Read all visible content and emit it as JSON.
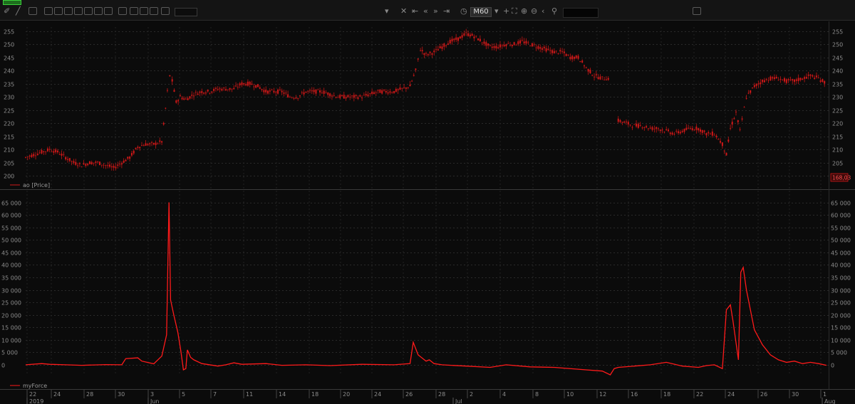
{
  "toolbar": {
    "timeframe": "M60"
  },
  "price_tag": "168,03",
  "chart_data": [
    {
      "type": "candlestick",
      "legend": "ao [Price]",
      "y_ticks": [
        255,
        250,
        245,
        240,
        235,
        230,
        225,
        220,
        215,
        210,
        205,
        200
      ],
      "ylim": [
        199.5,
        256.5
      ],
      "grid": true,
      "color": "#d01818",
      "series_points": [
        [
          0,
          207
        ],
        [
          1,
          208
        ],
        [
          2,
          209
        ],
        [
          3,
          210
        ],
        [
          4,
          209
        ],
        [
          5,
          207
        ],
        [
          6,
          205
        ],
        [
          7,
          204
        ],
        [
          8,
          205
        ],
        [
          9,
          205
        ],
        [
          10,
          204
        ],
        [
          11,
          203
        ],
        [
          12,
          205
        ],
        [
          13,
          207
        ],
        [
          14,
          211
        ],
        [
          15,
          212
        ],
        [
          16,
          212
        ],
        [
          17,
          213
        ],
        [
          17.7,
          232
        ],
        [
          18,
          238
        ],
        [
          18.3,
          236
        ],
        [
          18.8,
          228
        ],
        [
          19.3,
          230
        ],
        [
          20,
          229
        ],
        [
          21,
          231
        ],
        [
          22,
          232
        ],
        [
          23,
          232
        ],
        [
          24,
          233
        ],
        [
          25,
          233
        ],
        [
          26,
          233
        ],
        [
          27,
          235
        ],
        [
          28,
          235
        ],
        [
          29,
          234
        ],
        [
          30,
          232
        ],
        [
          31,
          232
        ],
        [
          32,
          232
        ],
        [
          33,
          230
        ],
        [
          34,
          230
        ],
        [
          35,
          232
        ],
        [
          36,
          232
        ],
        [
          37,
          232
        ],
        [
          38,
          231
        ],
        [
          39,
          230
        ],
        [
          40,
          230
        ],
        [
          41,
          230
        ],
        [
          42,
          230
        ],
        [
          43,
          231
        ],
        [
          44,
          232
        ],
        [
          45,
          232
        ],
        [
          46,
          232
        ],
        [
          47,
          233
        ],
        [
          48,
          234
        ],
        [
          48.7,
          240
        ],
        [
          49.3,
          248
        ],
        [
          50,
          246
        ],
        [
          51,
          247
        ],
        [
          52,
          249
        ],
        [
          53,
          251
        ],
        [
          54,
          252
        ],
        [
          55,
          254
        ],
        [
          56,
          253
        ],
        [
          57,
          251
        ],
        [
          58,
          249
        ],
        [
          59,
          249
        ],
        [
          60,
          250
        ],
        [
          61,
          250
        ],
        [
          62,
          251
        ],
        [
          63,
          250
        ],
        [
          64,
          249
        ],
        [
          65,
          248
        ],
        [
          66,
          247
        ],
        [
          67,
          247
        ],
        [
          68,
          245
        ],
        [
          69,
          245
        ],
        [
          70,
          241
        ],
        [
          71,
          238
        ],
        [
          72,
          237
        ],
        [
          73,
          237
        ],
        [
          74,
          221
        ],
        [
          75,
          220
        ],
        [
          76,
          219
        ],
        [
          77,
          219
        ],
        [
          78,
          218
        ],
        [
          79,
          218
        ],
        [
          80,
          217
        ],
        [
          81,
          216
        ],
        [
          82,
          217
        ],
        [
          83,
          218
        ],
        [
          84,
          218
        ],
        [
          85,
          216
        ],
        [
          86,
          216
        ],
        [
          87,
          212
        ],
        [
          87.5,
          208
        ],
        [
          88,
          218
        ],
        [
          88.7,
          224
        ],
        [
          89.2,
          217
        ],
        [
          90,
          230
        ],
        [
          91,
          234
        ],
        [
          92,
          236
        ],
        [
          93,
          237
        ],
        [
          94,
          237
        ],
        [
          95,
          236
        ],
        [
          96,
          236
        ],
        [
          97,
          237
        ],
        [
          98,
          238
        ],
        [
          99,
          237
        ],
        [
          100,
          235
        ]
      ]
    },
    {
      "type": "line",
      "legend": "myForce",
      "y_ticks": [
        65000,
        60000,
        55000,
        50000,
        45000,
        40000,
        35000,
        30000,
        25000,
        20000,
        15000,
        10000,
        5000,
        0
      ],
      "y_tick_labels": [
        "65 000",
        "60 000",
        "55 000",
        "50 000",
        "45 000",
        "40 000",
        "35 000",
        "30 000",
        "25 000",
        "20 000",
        "15 000",
        "10 000",
        "5 000",
        "0"
      ],
      "ylim": [
        -4000,
        66000
      ],
      "grid": true,
      "color": "#ff1a1a",
      "x": [
        0,
        2,
        3,
        5,
        7,
        10,
        12,
        12.5,
        14,
        14.5,
        16,
        17,
        17.6,
        17.9,
        18.1,
        18.5,
        19,
        19.4,
        19.7,
        20,
        20.2,
        20.6,
        21,
        22,
        24,
        25,
        26,
        27,
        30,
        32,
        35,
        38,
        42,
        46,
        48,
        48.4,
        49,
        50,
        50.4,
        51,
        52,
        55,
        58,
        60,
        63,
        66,
        70,
        72,
        73,
        73.5,
        74,
        76,
        78,
        80,
        82,
        84,
        85,
        86,
        87,
        87.5,
        88,
        88.3,
        89,
        89.3,
        89.6,
        90,
        90.5,
        91,
        92,
        93,
        94,
        95,
        96,
        97,
        98,
        99,
        100
      ],
      "y": [
        0,
        500,
        200,
        0,
        -200,
        100,
        0,
        2500,
        2800,
        1500,
        400,
        3500,
        12000,
        65000,
        26000,
        20000,
        13000,
        5000,
        -2000,
        -1500,
        6000,
        3000,
        2000,
        500,
        -500,
        0,
        800,
        200,
        500,
        -200,
        0,
        -300,
        200,
        0,
        500,
        9000,
        4000,
        1500,
        2000,
        500,
        0,
        -500,
        -1000,
        0,
        -800,
        -1000,
        -2000,
        -2500,
        -4000,
        -1500,
        -1000,
        -500,
        0,
        1000,
        -500,
        -1000,
        -300,
        0,
        -1500,
        22000,
        24000,
        18000,
        2000,
        37000,
        39000,
        30000,
        22000,
        14000,
        8000,
        4000,
        2000,
        1000,
        1500,
        500,
        1000,
        500,
        -200
      ]
    }
  ],
  "x_axis": {
    "day_ticks": [
      "22",
      "24",
      "28",
      "30",
      "3",
      "5",
      "7",
      "11",
      "14",
      "18",
      "20",
      "24",
      "26",
      "28",
      "2",
      "4",
      "8",
      "10",
      "12",
      "16",
      "18",
      "22",
      "24",
      "26",
      "30",
      "1"
    ],
    "period_labels": [
      "2019",
      "Jun",
      "Jul",
      "Aug"
    ]
  }
}
